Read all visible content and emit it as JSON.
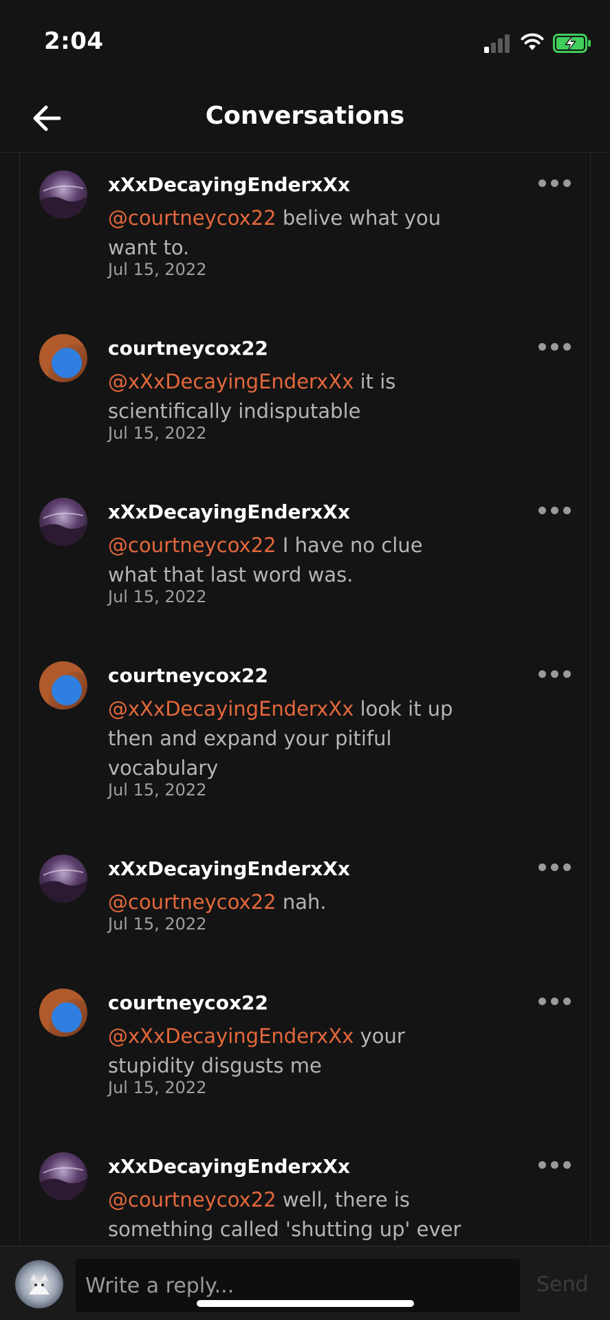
{
  "status_bar": {
    "time": "2:04",
    "icons": [
      "cellular-signal-icon",
      "wifi-icon",
      "battery-charging-icon"
    ]
  },
  "header": {
    "title": "Conversations",
    "back_icon": "arrow-left-icon"
  },
  "colors": {
    "background": "#141414",
    "mention": "#e4683c",
    "text_primary": "#ffffff",
    "text_secondary": "#b5b5b5",
    "battery": "#3fcf5a"
  },
  "comments": [
    {
      "username": "xXxDecayingEnderxXx",
      "avatar": "purple-sky-avatar",
      "mention": "@courtneycox22",
      "text": "belive what you want to.",
      "date": "Jul 15, 2022"
    },
    {
      "username": "courtneycox22",
      "avatar": "rock-arch-avatar",
      "mention": "@xXxDecayingEnderxXx",
      "text": "it is scientifically indisputable",
      "date": "Jul 15, 2022"
    },
    {
      "username": "xXxDecayingEnderxXx",
      "avatar": "purple-sky-avatar",
      "mention": "@courtneycox22",
      "text": "I have no clue what that last word was.",
      "date": "Jul 15, 2022"
    },
    {
      "username": "courtneycox22",
      "avatar": "rock-arch-avatar",
      "mention": "@xXxDecayingEnderxXx",
      "text": "look it up then and expand your pitiful vocabulary",
      "date": "Jul 15, 2022"
    },
    {
      "username": "xXxDecayingEnderxXx",
      "avatar": "purple-sky-avatar",
      "mention": "@courtneycox22",
      "text": "nah.",
      "date": "Jul 15, 2022"
    },
    {
      "username": "courtneycox22",
      "avatar": "rock-arch-avatar",
      "mention": "@xXxDecayingEnderxXx",
      "text": "your stupidity disgusts me",
      "date": "Jul 15, 2022"
    },
    {
      "username": "xXxDecayingEnderxXx",
      "avatar": "purple-sky-avatar",
      "mention": "@courtneycox22",
      "text": "well, there is something called 'shutting up' ever heard of it?",
      "date": ""
    }
  ],
  "reply_bar": {
    "placeholder": "Write a reply...",
    "send_label": "Send",
    "avatar": "white-cat-avatar"
  }
}
